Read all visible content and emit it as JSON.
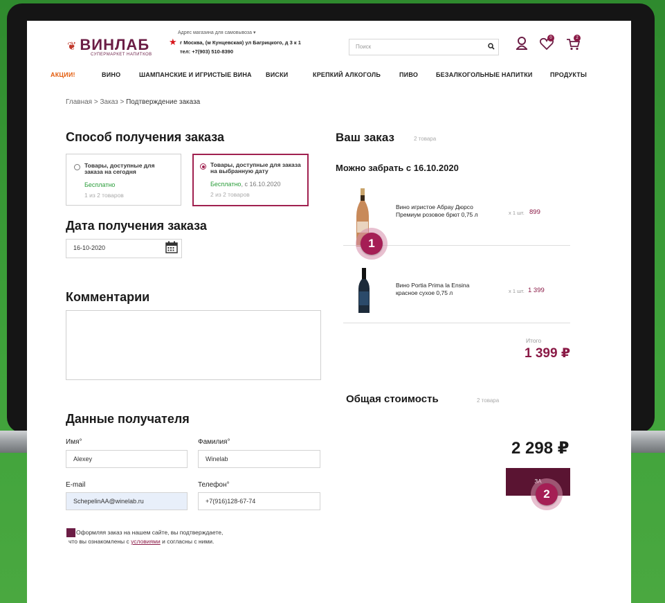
{
  "header": {
    "logo": "ВИНЛАБ",
    "logo_sub": "СУПЕРМАРКЕТ НАПИТКОВ",
    "store_label": "Адрес магазина для самовывоза ▾",
    "store_address": "г Москва, (м Кунцевская) ул Багрицкого, д 3 к 1",
    "store_phone": "тел: +7(903) 510-8390",
    "search_placeholder": "Поиск",
    "wishlist_count": "0",
    "cart_count": "2"
  },
  "nav": [
    "АКЦИИ!",
    "ВИНО",
    "ШАМПАНСКИЕ И ИГРИСТЫЕ ВИНА",
    "ВИСКИ",
    "КРЕПКИЙ АЛКОГОЛЬ",
    "ПИВО",
    "БЕЗАЛКОГОЛЬНЫЕ НАПИТКИ",
    "ПРОДУКТЫ"
  ],
  "breadcrumb": {
    "home": "Главная",
    "sep": " > ",
    "order": "Заказ",
    "current": "Подтверждение заказа"
  },
  "delivery": {
    "title": "Способ получения заказа",
    "options": [
      {
        "title": "Товары, доступные для заказа на сегодня",
        "price": "Бесплатно",
        "date": "",
        "count": "1 из 2 товаров",
        "selected": false
      },
      {
        "title": "Товары, доступные для заказа на выбранную дату",
        "price": "Бесплатно",
        "date": ", с 16.10.2020",
        "count": "2 из 2 товаров",
        "selected": true
      }
    ]
  },
  "date": {
    "title": "Дата получения заказа",
    "value": "16-10-2020"
  },
  "comments": {
    "title": "Комментарии"
  },
  "recipient": {
    "title": "Данные получателя",
    "first_name_label": "Имя°",
    "first_name": "Alexey",
    "last_name_label": "Фамилия°",
    "last_name": "Winelab",
    "email_label": "E-mail",
    "email": "SchepelinAA@winelab.ru",
    "phone_label": "Телефон°",
    "phone": "+7(916)128-67-74"
  },
  "agreement": {
    "text1": "Оформляя заказ на нашем сайте, вы подтверждаете,",
    "text2_pre": "что вы ознакомлены с ",
    "link": "условиями",
    "text2_post": " и согласны с ними."
  },
  "order": {
    "title": "Ваш заказ",
    "count": "2 товара",
    "pickup": "Можно забрать с 16.10.2020",
    "items": [
      {
        "name_line1": "Вино игристое Абрау Дюрсо",
        "name_line2": "Премиум розовое брют 0,75 л",
        "qty": "х 1 шт.",
        "price": "899"
      },
      {
        "name_line1": "Вино Portia Prima la Ensina",
        "name_line2": "красное сухое 0,75 л",
        "qty": "х 1 шт.",
        "price": "1 399"
      }
    ],
    "total_label": "Итого",
    "total": "1 399 ₽"
  },
  "summary": {
    "title": "Общая стоимость",
    "count": "2 товара",
    "grand_total": "2 298 ₽",
    "button": "ЗА"
  },
  "markers": [
    "1",
    "2"
  ],
  "colors": {
    "brand": "#6b1d45",
    "accent": "#a51e55",
    "green": "#3f9a3a"
  }
}
